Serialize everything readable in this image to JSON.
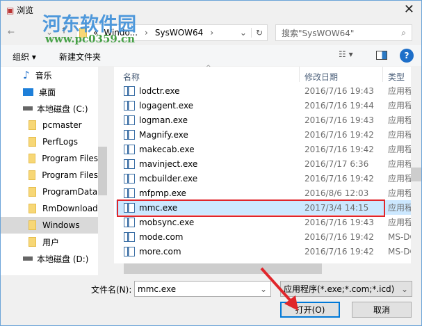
{
  "window": {
    "title": "浏览",
    "close": "✕"
  },
  "watermark": {
    "name": "河东软件园",
    "url": "www.pc0359.cn"
  },
  "address": {
    "overflow": "«",
    "crumbs": [
      "Windo...",
      "SysWOW64"
    ],
    "sep": "›"
  },
  "search": {
    "placeholder": "搜索\"SysWOW64\""
  },
  "toolbar": {
    "organize": "组织 ▾",
    "new_folder": "新建文件夹",
    "help": "?"
  },
  "nav": [
    {
      "label": "音乐",
      "icon": "music-icon"
    },
    {
      "label": "桌面",
      "icon": "desktop-icon"
    },
    {
      "label": "本地磁盘 (C:)",
      "icon": "drive-icon"
    },
    {
      "label": "pcmaster",
      "icon": "folder-icon"
    },
    {
      "label": "PerfLogs",
      "icon": "folder-icon"
    },
    {
      "label": "Program Files",
      "icon": "folder-icon"
    },
    {
      "label": "Program Files",
      "icon": "folder-icon"
    },
    {
      "label": "ProgramData",
      "icon": "folder-icon"
    },
    {
      "label": "RmDownload",
      "icon": "folder-icon"
    },
    {
      "label": "Windows",
      "icon": "folder-icon",
      "selected": true
    },
    {
      "label": "用户",
      "icon": "folder-icon"
    },
    {
      "label": "本地磁盘 (D:)",
      "icon": "drive-icon"
    }
  ],
  "columns": {
    "name": "名称",
    "date": "修改日期",
    "type": "类型"
  },
  "files": [
    {
      "name": "lodctr.exe",
      "date": "2016/7/16 19:43",
      "type": "应用程序"
    },
    {
      "name": "logagent.exe",
      "date": "2016/7/16 19:44",
      "type": "应用程序"
    },
    {
      "name": "logman.exe",
      "date": "2016/7/16 19:43",
      "type": "应用程序"
    },
    {
      "name": "Magnify.exe",
      "date": "2016/7/16 19:42",
      "type": "应用程序"
    },
    {
      "name": "makecab.exe",
      "date": "2016/7/16 19:42",
      "type": "应用程序"
    },
    {
      "name": "mavinject.exe",
      "date": "2016/7/17 6:36",
      "type": "应用程序"
    },
    {
      "name": "mcbuilder.exe",
      "date": "2016/7/16 19:42",
      "type": "应用程序"
    },
    {
      "name": "mfpmp.exe",
      "date": "2016/8/6 12:03",
      "type": "应用程序"
    },
    {
      "name": "mmc.exe",
      "date": "2017/3/4 14:15",
      "type": "应用程序",
      "selected": true
    },
    {
      "name": "mobsync.exe",
      "date": "2016/7/16 19:43",
      "type": "应用程序"
    },
    {
      "name": "mode.com",
      "date": "2016/7/16 19:42",
      "type": "MS-DOS"
    },
    {
      "name": "more.com",
      "date": "2016/7/16 19:42",
      "type": "MS-DOS"
    }
  ],
  "footer": {
    "filename_label": "文件名(N):",
    "filename_value": "mmc.exe",
    "filter": "应用程序(*.exe;*.com;*.icd)",
    "open": "打开(O)",
    "cancel": "取消"
  },
  "colors": {
    "highlight": "#e0262b",
    "accent": "#0078d7"
  }
}
